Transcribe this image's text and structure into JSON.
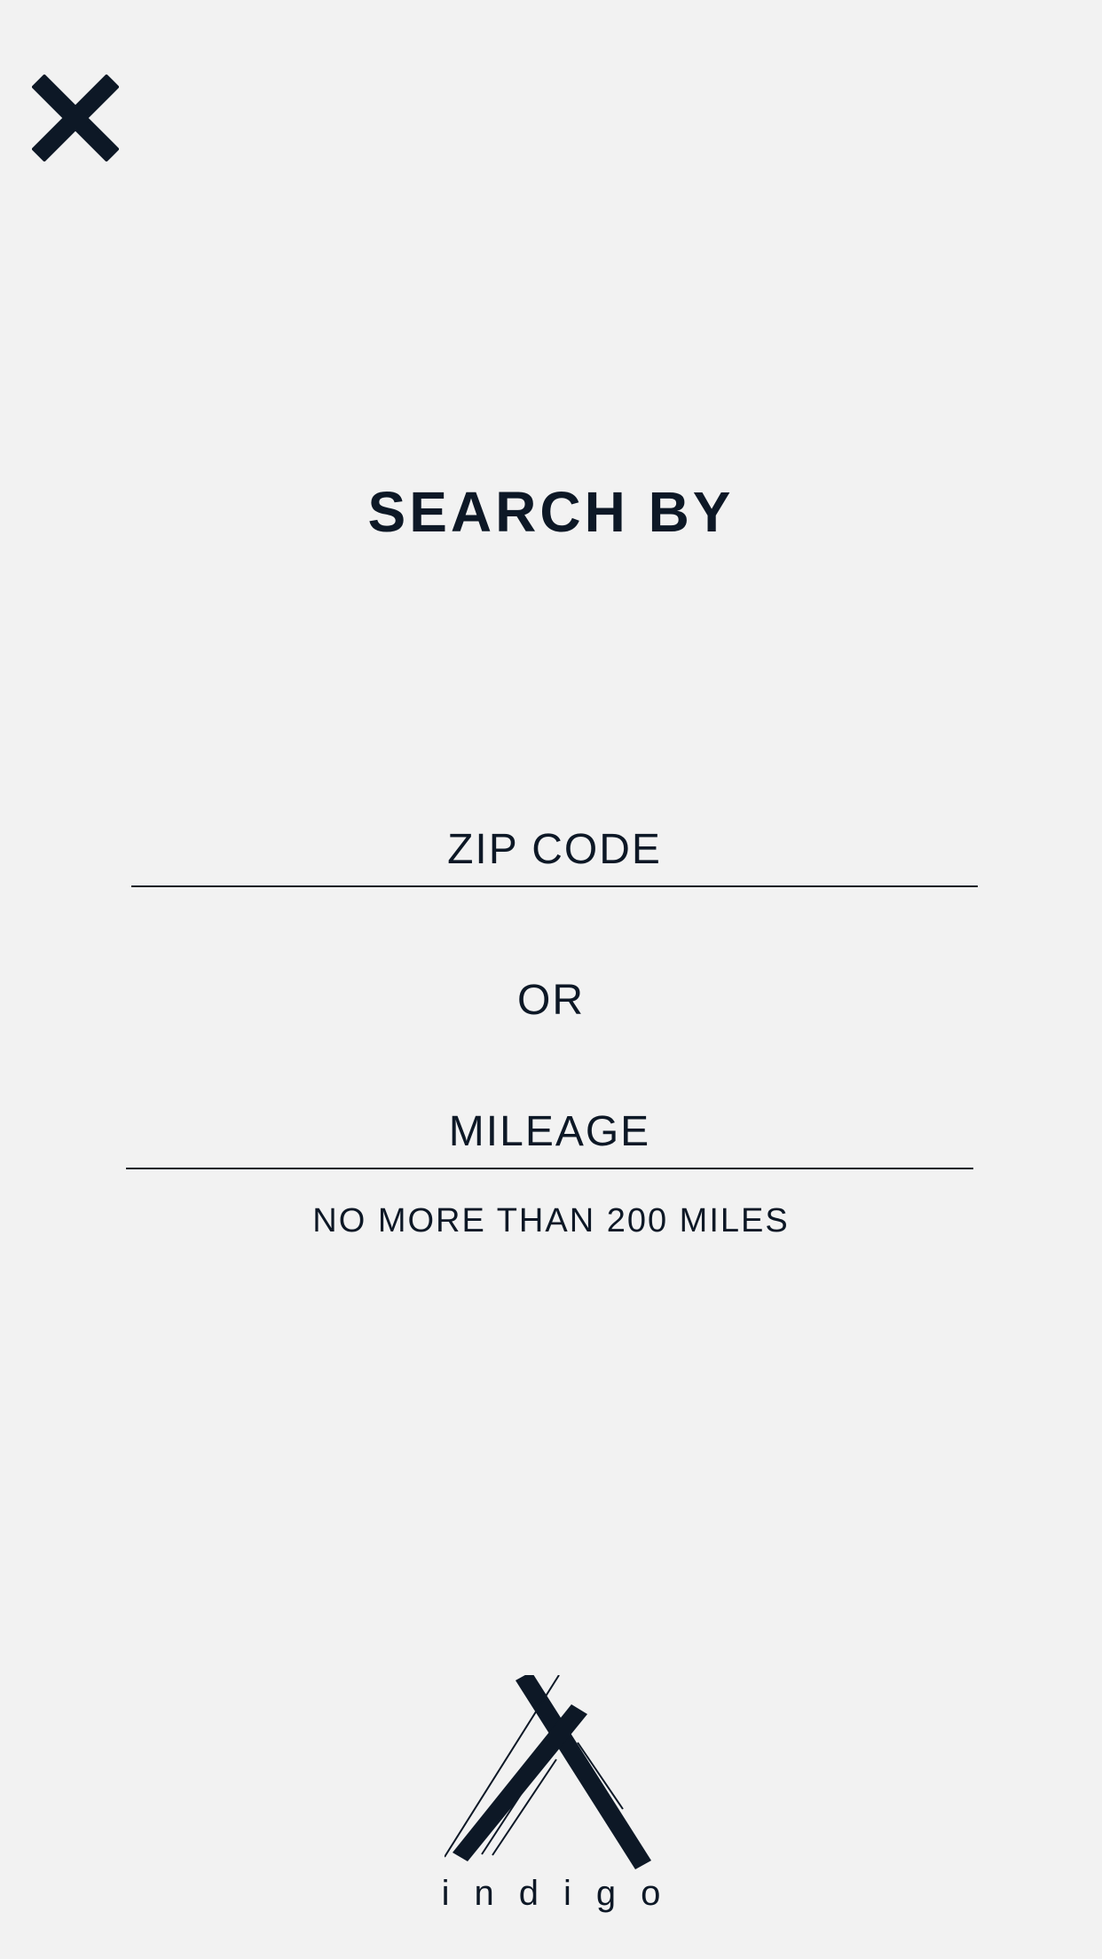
{
  "header": {
    "close_icon": "close-icon"
  },
  "title": "SEARCH BY",
  "form": {
    "zip_placeholder": "ZIP CODE",
    "zip_value": "",
    "separator": "OR",
    "mileage_placeholder": "MILEAGE",
    "mileage_value": "",
    "mileage_hint": "NO MORE THAN 200 MILES"
  },
  "footer": {
    "logo_icon": "indigo-logo-icon",
    "brand_name": "indigo"
  },
  "colors": {
    "background": "#f2f2f2",
    "ink": "#0d1826"
  }
}
